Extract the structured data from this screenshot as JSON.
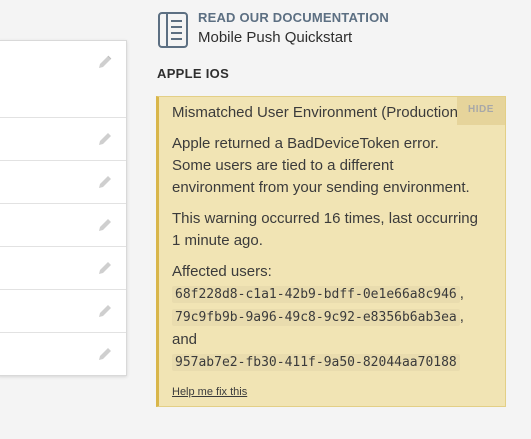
{
  "documentation": {
    "heading": "READ OUR DOCUMENTATION",
    "title": "Mobile Push Quickstart",
    "icon": "document-icon"
  },
  "section": {
    "title": "APPLE IOS"
  },
  "warning": {
    "title": "Mismatched User Environment (Production)",
    "hide_label": "HIDE",
    "description_lines": [
      "Apple returned a BadDeviceToken error.",
      "Some users are tied to a different",
      "environment from your sending environment."
    ],
    "occurrence_lines": [
      "This warning occurred 16 times, last occurring",
      "1 minute ago."
    ],
    "affected_label": "Affected users:",
    "users": [
      "68f228d8-c1a1-42b9-bdff-0e1e66a8c946",
      "79c9fb9b-9a96-49c8-9c92-e8356b6ab3ea",
      "957ab7e2-fb30-411f-9a50-82044aa70188"
    ],
    "separator_comma": ",",
    "and_text": "and",
    "help_link": "Help me fix this"
  },
  "colors": {
    "warning_bg": "#f1e4b4",
    "warning_accent": "#d9b64a",
    "doc_heading": "#5c6f82"
  }
}
